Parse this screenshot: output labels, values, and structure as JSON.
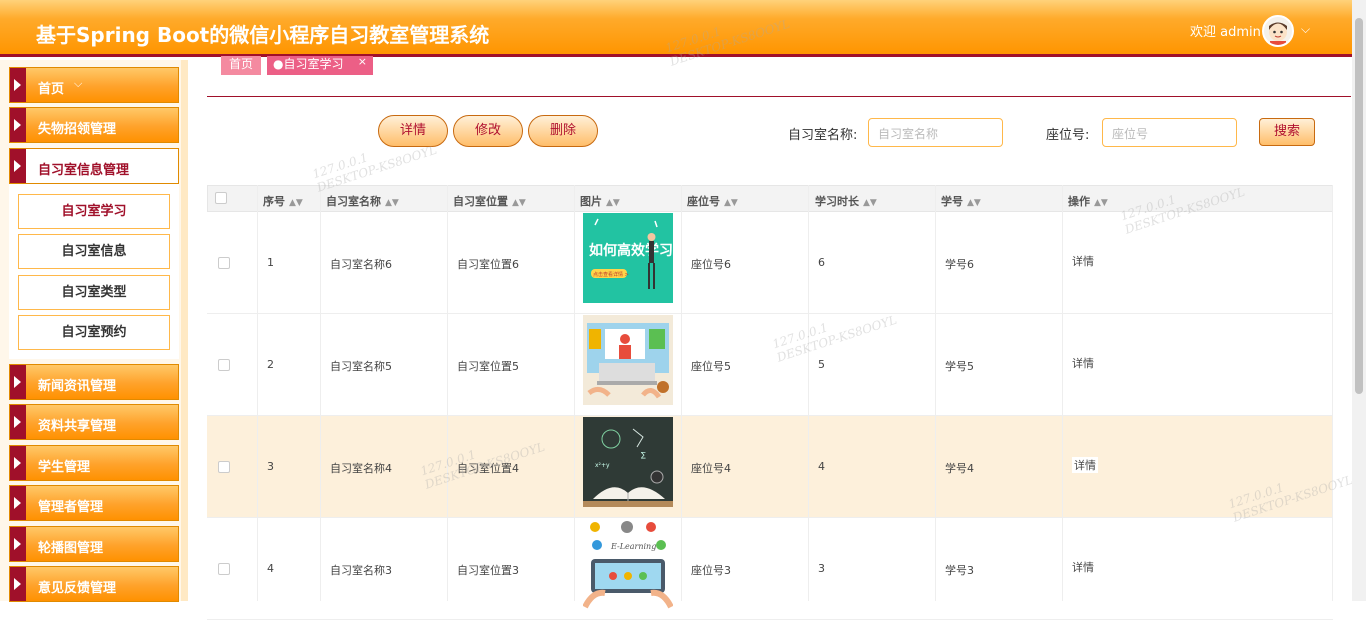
{
  "header": {
    "title": "基于Spring Boot的微信小程序自习教室管理系统",
    "welcome": "欢迎 admin"
  },
  "sidebar": {
    "menus": [
      {
        "label": "首页"
      },
      {
        "label": "失物招领管理"
      },
      {
        "label": "自习室信息管理"
      },
      {
        "label": "新闻资讯管理"
      },
      {
        "label": "资料共享管理"
      },
      {
        "label": "学生管理"
      },
      {
        "label": "管理者管理"
      },
      {
        "label": "轮播图管理"
      },
      {
        "label": "意见反馈管理"
      }
    ],
    "submenu": [
      {
        "label": "自习室学习"
      },
      {
        "label": "自习室信息"
      },
      {
        "label": "自习室类型"
      },
      {
        "label": "自习室预约"
      }
    ]
  },
  "tabs": {
    "home": "首页",
    "current": "●自习室学习",
    "close": "×"
  },
  "toolbar": {
    "detail": "详情",
    "edit": "修改",
    "delete": "删除",
    "name_label": "自习室名称:",
    "name_placeholder": "自习室名称",
    "seat_label": "座位号:",
    "seat_placeholder": "座位号",
    "search": "搜索"
  },
  "table": {
    "columns": [
      "序号",
      "自习室名称",
      "自习室位置",
      "图片",
      "座位号",
      "学习时长",
      "学号",
      "操作"
    ],
    "rows": [
      {
        "no": "1",
        "name": "自习室名称6",
        "location": "自习室位置6",
        "seat": "座位号6",
        "duration": "6",
        "student": "学号6",
        "action": "详情"
      },
      {
        "no": "2",
        "name": "自习室名称5",
        "location": "自习室位置5",
        "seat": "座位号5",
        "duration": "5",
        "student": "学号5",
        "action": "详情"
      },
      {
        "no": "3",
        "name": "自习室名称4",
        "location": "自习室位置4",
        "seat": "座位号4",
        "duration": "4",
        "student": "学号4",
        "action": "详情"
      },
      {
        "no": "4",
        "name": "自习室名称3",
        "location": "自习室位置3",
        "seat": "座位号3",
        "duration": "3",
        "student": "学号3",
        "action": "详情"
      }
    ]
  },
  "images": {
    "img1_title": "如何高效学习",
    "img1_btn": "点击查看详情 >",
    "img4_text": "E-Learning"
  },
  "watermark": {
    "ip": "127.0.0.1",
    "host": "DESKTOP-KS8OOYL"
  }
}
